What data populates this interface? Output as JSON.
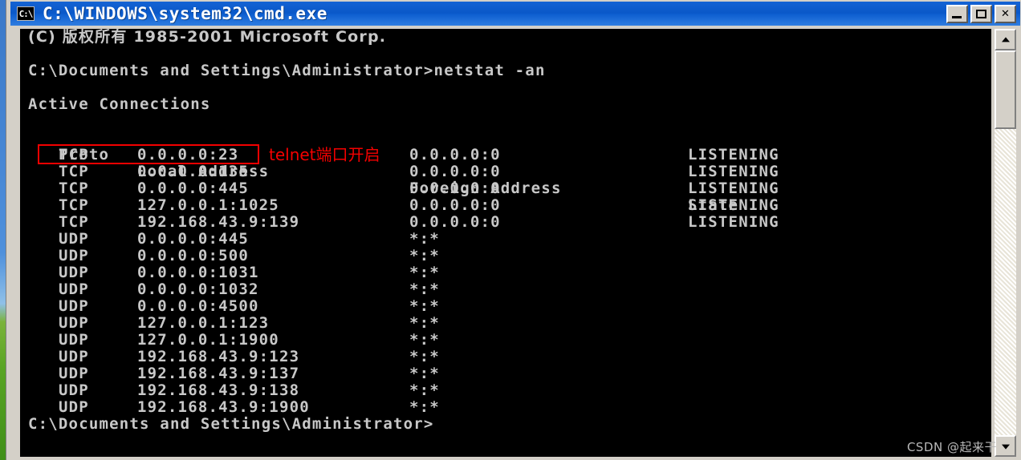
{
  "window": {
    "title": "C:\\WINDOWS\\system32\\cmd.exe",
    "icon_label": "C:\\",
    "icon_name": "console-icon",
    "buttons": {
      "minimize": "_",
      "maximize": "▢",
      "close": "✕"
    }
  },
  "console": {
    "copyright_line": "(C) 版权所有 1985-2001 Microsoft Corp.",
    "prompt_command_line": "C:\\Documents and Settings\\Administrator>netstat -an",
    "section_title": "Active Connections",
    "headers": {
      "proto": "Proto",
      "local": "Local Address",
      "foreign": "Foreign Address",
      "state": "State"
    },
    "rows": [
      {
        "proto": "TCP",
        "local": "0.0.0.0:23",
        "foreign": "0.0.0.0:0",
        "state": "LISTENING"
      },
      {
        "proto": "TCP",
        "local": "0.0.0.0:135",
        "foreign": "0.0.0.0:0",
        "state": "LISTENING"
      },
      {
        "proto": "TCP",
        "local": "0.0.0.0:445",
        "foreign": "0.0.0.0:0",
        "state": "LISTENING"
      },
      {
        "proto": "TCP",
        "local": "127.0.0.1:1025",
        "foreign": "0.0.0.0:0",
        "state": "LISTENING"
      },
      {
        "proto": "TCP",
        "local": "192.168.43.9:139",
        "foreign": "0.0.0.0:0",
        "state": "LISTENING"
      },
      {
        "proto": "UDP",
        "local": "0.0.0.0:445",
        "foreign": "*:*",
        "state": ""
      },
      {
        "proto": "UDP",
        "local": "0.0.0.0:500",
        "foreign": "*:*",
        "state": ""
      },
      {
        "proto": "UDP",
        "local": "0.0.0.0:1031",
        "foreign": "*:*",
        "state": ""
      },
      {
        "proto": "UDP",
        "local": "0.0.0.0:1032",
        "foreign": "*:*",
        "state": ""
      },
      {
        "proto": "UDP",
        "local": "0.0.0.0:4500",
        "foreign": "*:*",
        "state": ""
      },
      {
        "proto": "UDP",
        "local": "127.0.0.1:123",
        "foreign": "*:*",
        "state": ""
      },
      {
        "proto": "UDP",
        "local": "127.0.0.1:1900",
        "foreign": "*:*",
        "state": ""
      },
      {
        "proto": "UDP",
        "local": "192.168.43.9:123",
        "foreign": "*:*",
        "state": ""
      },
      {
        "proto": "UDP",
        "local": "192.168.43.9:137",
        "foreign": "*:*",
        "state": ""
      },
      {
        "proto": "UDP",
        "local": "192.168.43.9:138",
        "foreign": "*:*",
        "state": ""
      },
      {
        "proto": "UDP",
        "local": "192.168.43.9:1900",
        "foreign": "*:*",
        "state": ""
      }
    ],
    "final_prompt": "C:\\Documents and Settings\\Administrator>"
  },
  "annotation": {
    "label": "telnet端口开启",
    "color": "#f40000",
    "highlighted_row_index": 0
  },
  "scrollbar": {
    "up_arrow": "▲",
    "down_arrow": "▼"
  },
  "watermark": {
    "text": "CSDN @起来干"
  },
  "colors": {
    "title_bar": "#0a58c8",
    "console_bg": "#000000",
    "console_fg": "#c8c8c8",
    "frame": "#d4d0c8",
    "annotation": "#f40000"
  }
}
